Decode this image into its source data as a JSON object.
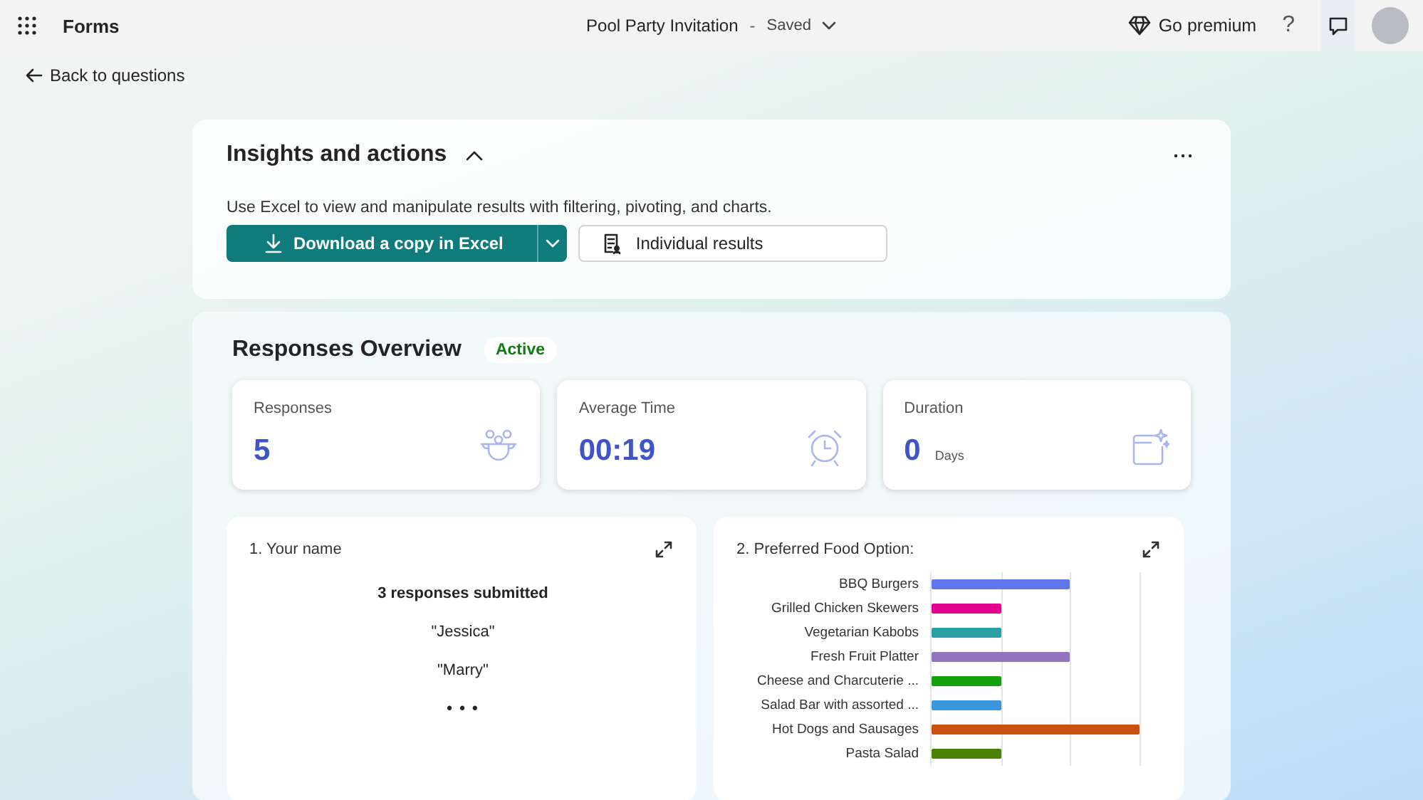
{
  "app": {
    "name": "Forms"
  },
  "document": {
    "title": "Pool Party Invitation",
    "separator": "-",
    "save_state": "Saved"
  },
  "header_actions": {
    "premium": "Go premium",
    "help": "?"
  },
  "back_link": "Back to questions",
  "insights": {
    "title": "Insights and actions",
    "expanded": true,
    "description": "Use Excel to view and manipulate results with filtering, pivoting, and charts.",
    "download_button": "Download a copy in Excel",
    "individual_button": "Individual results"
  },
  "overview": {
    "title": "Responses Overview",
    "status": "Active",
    "stats": [
      {
        "kind": "responses",
        "label": "Responses",
        "value": "5"
      },
      {
        "kind": "time",
        "label": "Average Time",
        "value": "00:19"
      },
      {
        "kind": "duration",
        "label": "Duration",
        "value": "0",
        "unit": "Days"
      }
    ]
  },
  "questions": [
    {
      "kind": "text",
      "title": "1. Your name",
      "summary": "3 responses submitted",
      "answers": [
        "\"Jessica\"",
        "\"Marry\""
      ],
      "more": "• • •"
    },
    {
      "kind": "choice",
      "title": "2. Preferred Food Option:",
      "options": [
        {
          "label": "BBQ Burgers",
          "color": "#6078ec"
        },
        {
          "label": "Grilled Chicken Skewers",
          "color": "#e3008c"
        },
        {
          "label": "Vegetarian Kabobs",
          "color": "#2aa0a4"
        },
        {
          "label": "Fresh Fruit Platter",
          "color": "#9373c0"
        },
        {
          "label": "Cheese and Charcuterie ...",
          "color": "#13a10e"
        },
        {
          "label": "Salad Bar with assorted ...",
          "color": "#3a96dd"
        },
        {
          "label": "Hot Dogs and Sausages",
          "color": "#ca5010"
        },
        {
          "label": "Pasta Salad",
          "color": "#498205"
        }
      ]
    }
  ]
}
